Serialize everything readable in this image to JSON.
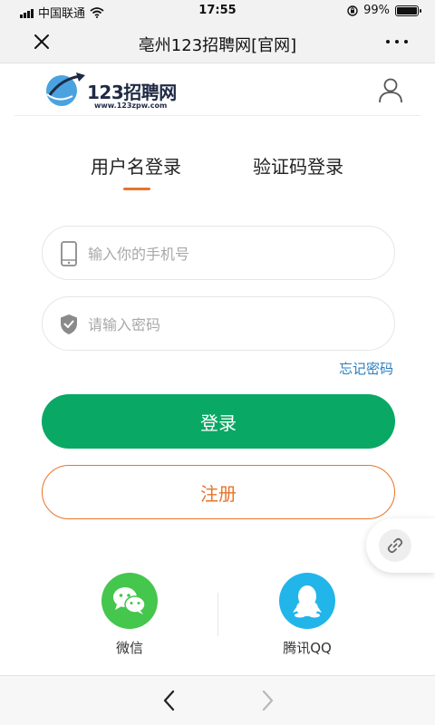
{
  "status_bar": {
    "carrier": "中国联通",
    "time": "17:55",
    "battery": "99%",
    "battery_level": 0.99
  },
  "nav_bar": {
    "title": "亳州123招聘网[官网]"
  },
  "header": {
    "logo_text": "123招聘网",
    "logo_url": "www.123zpw.com"
  },
  "tabs": [
    {
      "label": "用户名登录",
      "active": true
    },
    {
      "label": "验证码登录",
      "active": false
    }
  ],
  "form": {
    "phone_placeholder": "输入你的手机号",
    "password_placeholder": "请输入密码",
    "forgot_label": "忘记密码",
    "login_label": "登录",
    "register_label": "注册"
  },
  "social": {
    "wechat_label": "微信",
    "qq_label": "腾讯QQ"
  },
  "colors": {
    "accent_orange": "#e8742a",
    "login_green": "#0aa865",
    "link_blue": "#2a7fc0",
    "wechat_green": "#45c64d",
    "qq_blue": "#22b5ea"
  }
}
